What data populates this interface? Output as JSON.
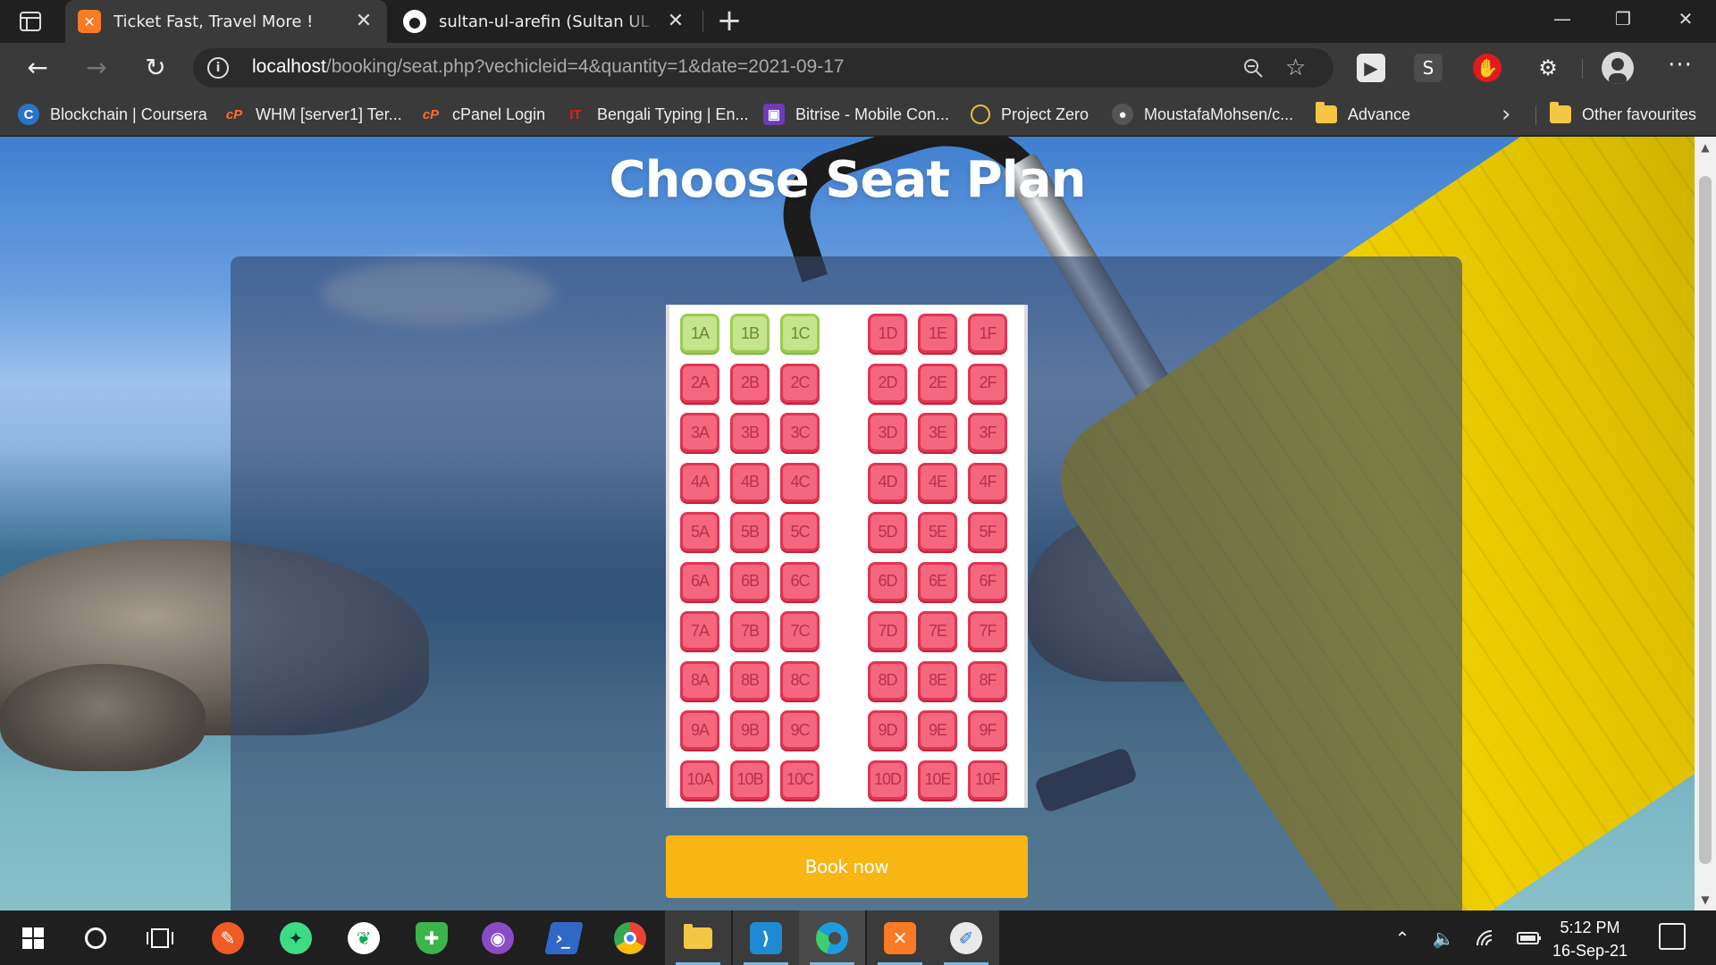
{
  "browser": {
    "tabs": [
      {
        "title": "Ticket Fast, Travel More !",
        "icon": "xampp-icon",
        "active": true
      },
      {
        "title": "sultan-ul-arefin (Sultan UL Arefin)",
        "icon": "github-icon",
        "active": false
      }
    ],
    "url_host": "localhost",
    "url_path": "/booking/seat.php?vechicleid=4&quantity=1&date=2021-09-17",
    "bookmarks": [
      {
        "label": "Blockchain | Coursera",
        "icon": "coursera-icon",
        "color": "#2a73cc"
      },
      {
        "label": "WHM [server1] Ter...",
        "icon": "cpanel-icon",
        "color": "#ff6c2c"
      },
      {
        "label": "cPanel Login",
        "icon": "cpanel-icon",
        "color": "#ff6c2c"
      },
      {
        "label": "Bengali Typing | En...",
        "icon": "typing-icon",
        "color": "#d22"
      },
      {
        "label": "Bitrise - Mobile Con...",
        "icon": "bitrise-icon",
        "color": "#6c3cb8"
      },
      {
        "label": "Project Zero",
        "icon": "circle-icon",
        "color": "#e6c23a"
      },
      {
        "label": "MoustafaMohsen/c...",
        "icon": "github-icon",
        "color": "#444"
      },
      {
        "label": "Advance",
        "icon": "folder-icon",
        "color": "#f2c744"
      }
    ],
    "other_favourites": "Other favourites"
  },
  "page": {
    "heading": "Choose Seat Plan",
    "rows": [
      "1",
      "2",
      "3",
      "4",
      "5",
      "6",
      "7",
      "8",
      "9",
      "10"
    ],
    "columns": [
      "A",
      "B",
      "C",
      "D",
      "E",
      "F"
    ],
    "available_seats": [
      "1A",
      "1B",
      "1C"
    ],
    "book_button": "Book now",
    "colors": {
      "booked_seat": "#f5677f",
      "available_seat": "#c5e48c",
      "book_button": "#f8b514"
    }
  },
  "taskbar": {
    "time": "5:12 PM",
    "date": "16-Sep-21"
  }
}
